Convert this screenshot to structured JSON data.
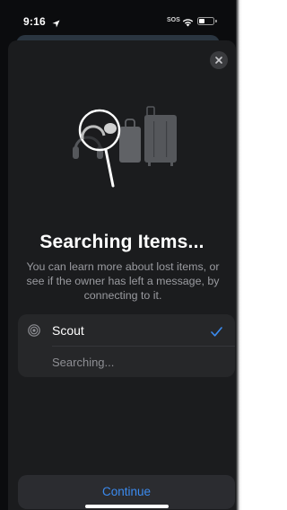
{
  "status_bar": {
    "time": "9:16",
    "carrier": "SOS",
    "location_icon": "location-arrow-icon",
    "wifi_icon": "wifi-icon",
    "battery_icon": "battery-icon",
    "battery_level": 0.35
  },
  "sheet": {
    "close_icon": "close-icon",
    "illustration": "magnifying-glass-over-items-illustration",
    "title": "Searching Items...",
    "description": "You can learn more about lost items, or see if the owner has left a message, by connecting to it."
  },
  "items": [
    {
      "name": "Scout",
      "icon": "airtag-icon",
      "selected": true,
      "check_icon": "checkmark-icon",
      "status": "Searching..."
    }
  ],
  "actions": {
    "continue_label": "Continue"
  },
  "colors": {
    "background": "#0b0c0e",
    "sheet": "#1b1c1e",
    "card": "#262729",
    "accent": "#3b8bf0",
    "secondary_text": "#9a9ba0"
  }
}
